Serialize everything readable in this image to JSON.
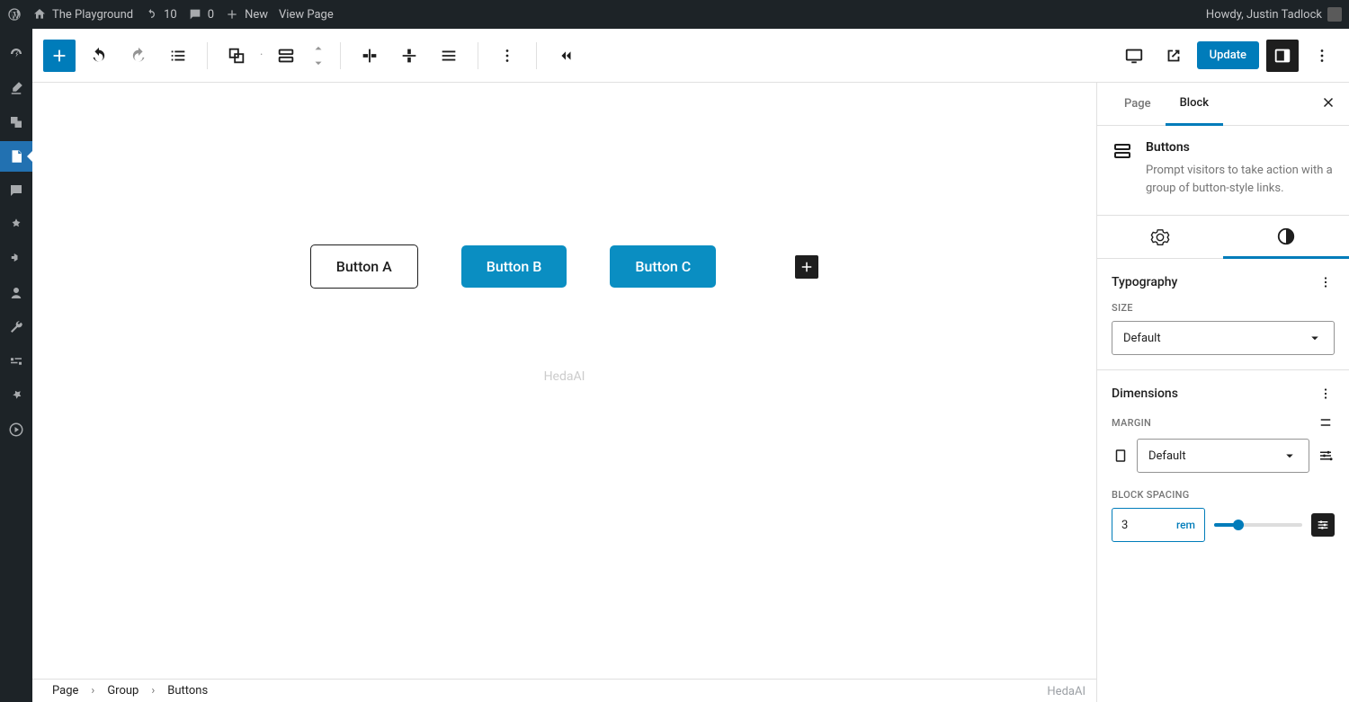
{
  "adminbar": {
    "site_name": "The Playground",
    "updates": "10",
    "comments": "0",
    "new": "New",
    "view_page": "View Page",
    "howdy": "Howdy, Justin Tadlock"
  },
  "toolbar": {
    "update": "Update"
  },
  "canvas": {
    "buttons": [
      "Button A",
      "Button B",
      "Button C"
    ],
    "watermark": "HedaAI"
  },
  "breadcrumb": [
    "Page",
    "Group",
    "Buttons"
  ],
  "sidebar": {
    "tabs": {
      "page": "Page",
      "block": "Block"
    },
    "block": {
      "title": "Buttons",
      "description": "Prompt visitors to take action with a group of button-style links."
    },
    "typography": {
      "heading": "Typography",
      "size_label": "Size",
      "size_value": "Default"
    },
    "dimensions": {
      "heading": "Dimensions",
      "margin_label": "Margin",
      "margin_value": "Default",
      "spacing_label": "Block Spacing",
      "spacing_value": "3",
      "spacing_unit": "rem"
    }
  },
  "footer_tag": "HedaAI"
}
